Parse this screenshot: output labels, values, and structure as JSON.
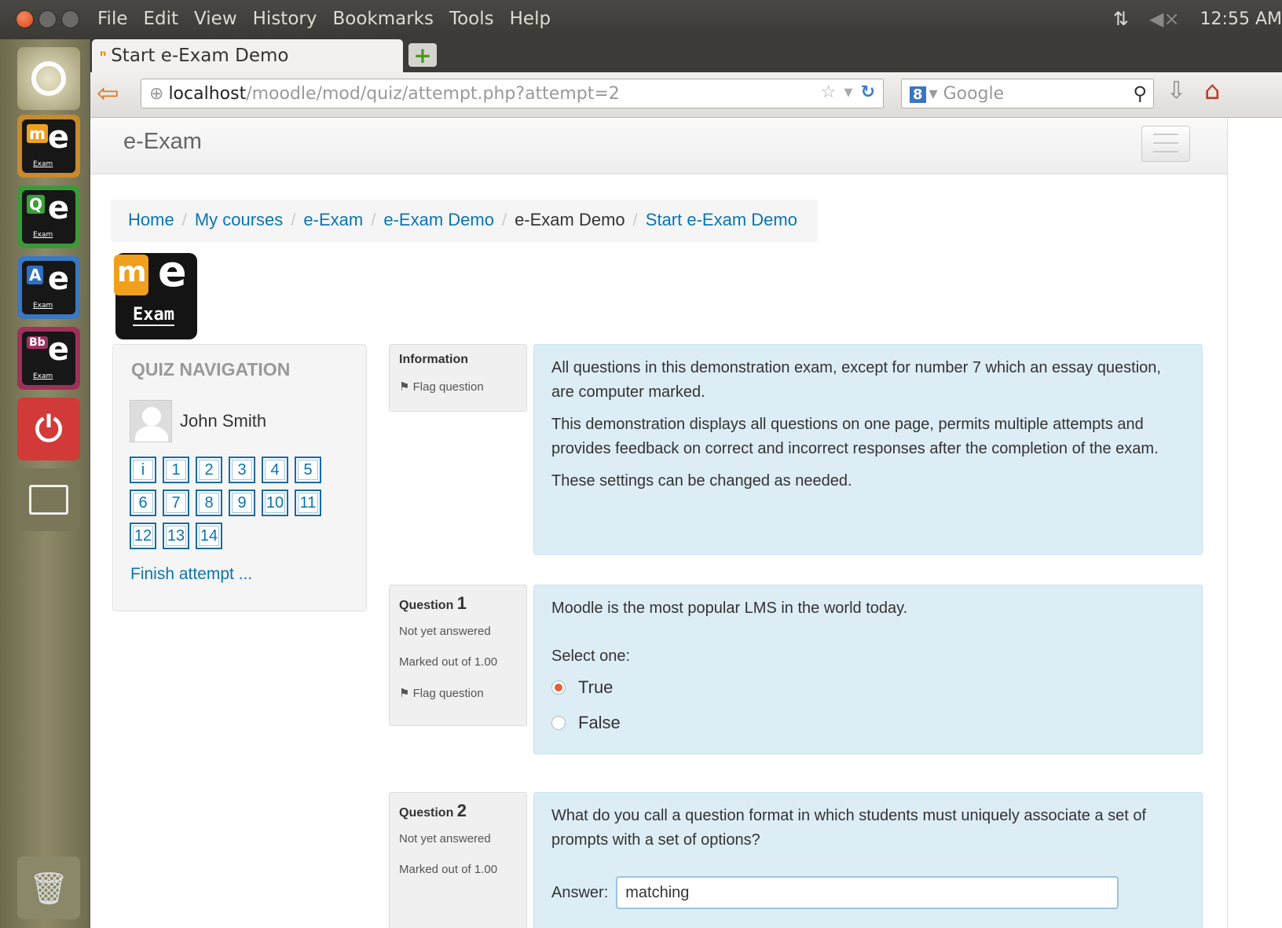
{
  "os": {
    "menus": [
      "File",
      "Edit",
      "View",
      "History",
      "Bookmarks",
      "Tools",
      "Help"
    ],
    "clock": "12:55 AM"
  },
  "launcher": [
    {
      "small": "m",
      "big": "e",
      "label": "Exam",
      "color": "#f0a01c"
    },
    {
      "small": "Q",
      "big": "e",
      "label": "Exam",
      "color": "#3aa03a"
    },
    {
      "small": "A",
      "big": "e",
      "label": "Exam",
      "color": "#3070c0"
    },
    {
      "small": "Bb",
      "big": "e",
      "label": "Exam",
      "color": "#a03060"
    }
  ],
  "browser": {
    "tab_title": "Start e-Exam Demo",
    "url_host": "localhost",
    "url_path": "/moodle/mod/quiz/attempt.php?attempt=2",
    "search_placeholder": "Google"
  },
  "site": {
    "name": "e-Exam",
    "breadcrumb": [
      {
        "label": "Home",
        "link": true
      },
      {
        "label": "My courses",
        "link": true
      },
      {
        "label": "e-Exam",
        "link": true
      },
      {
        "label": "e-Exam Demo",
        "link": true
      },
      {
        "label": "e-Exam Demo",
        "link": false
      },
      {
        "label": "Start e-Exam Demo",
        "link": true
      }
    ],
    "logo_text": "Exam"
  },
  "quiz_nav": {
    "title": "QUIZ NAVIGATION",
    "user": "John Smith",
    "buttons": [
      "i",
      "1",
      "2",
      "3",
      "4",
      "5",
      "6",
      "7",
      "8",
      "9",
      "10",
      "11",
      "12",
      "13",
      "14"
    ],
    "finish": "Finish attempt ..."
  },
  "info_block": {
    "title": "Information",
    "flag": "Flag question",
    "paragraphs": [
      "All questions in this demonstration exam, except for number 7 which an essay question, are computer marked.",
      "This demonstration displays all questions on one page, permits multiple attempts and provides feedback on correct and incorrect responses after the completion of the exam.",
      "These settings can be changed as needed."
    ]
  },
  "questions": [
    {
      "label": "Question",
      "number": "1",
      "status": "Not yet answered",
      "marks": "Marked out of 1.00",
      "flag": "Flag question",
      "text": "Moodle is the most popular LMS in the world today.",
      "prompt": "Select one:",
      "options": [
        {
          "label": "True",
          "selected": true
        },
        {
          "label": "False",
          "selected": false
        }
      ]
    },
    {
      "label": "Question",
      "number": "2",
      "status": "Not yet answered",
      "marks": "Marked out of 1.00",
      "text": "What do you call a question format in which students must uniquely associate a set of prompts with a set of options?",
      "answer_label": "Answer:",
      "answer_value": "matching"
    }
  ]
}
